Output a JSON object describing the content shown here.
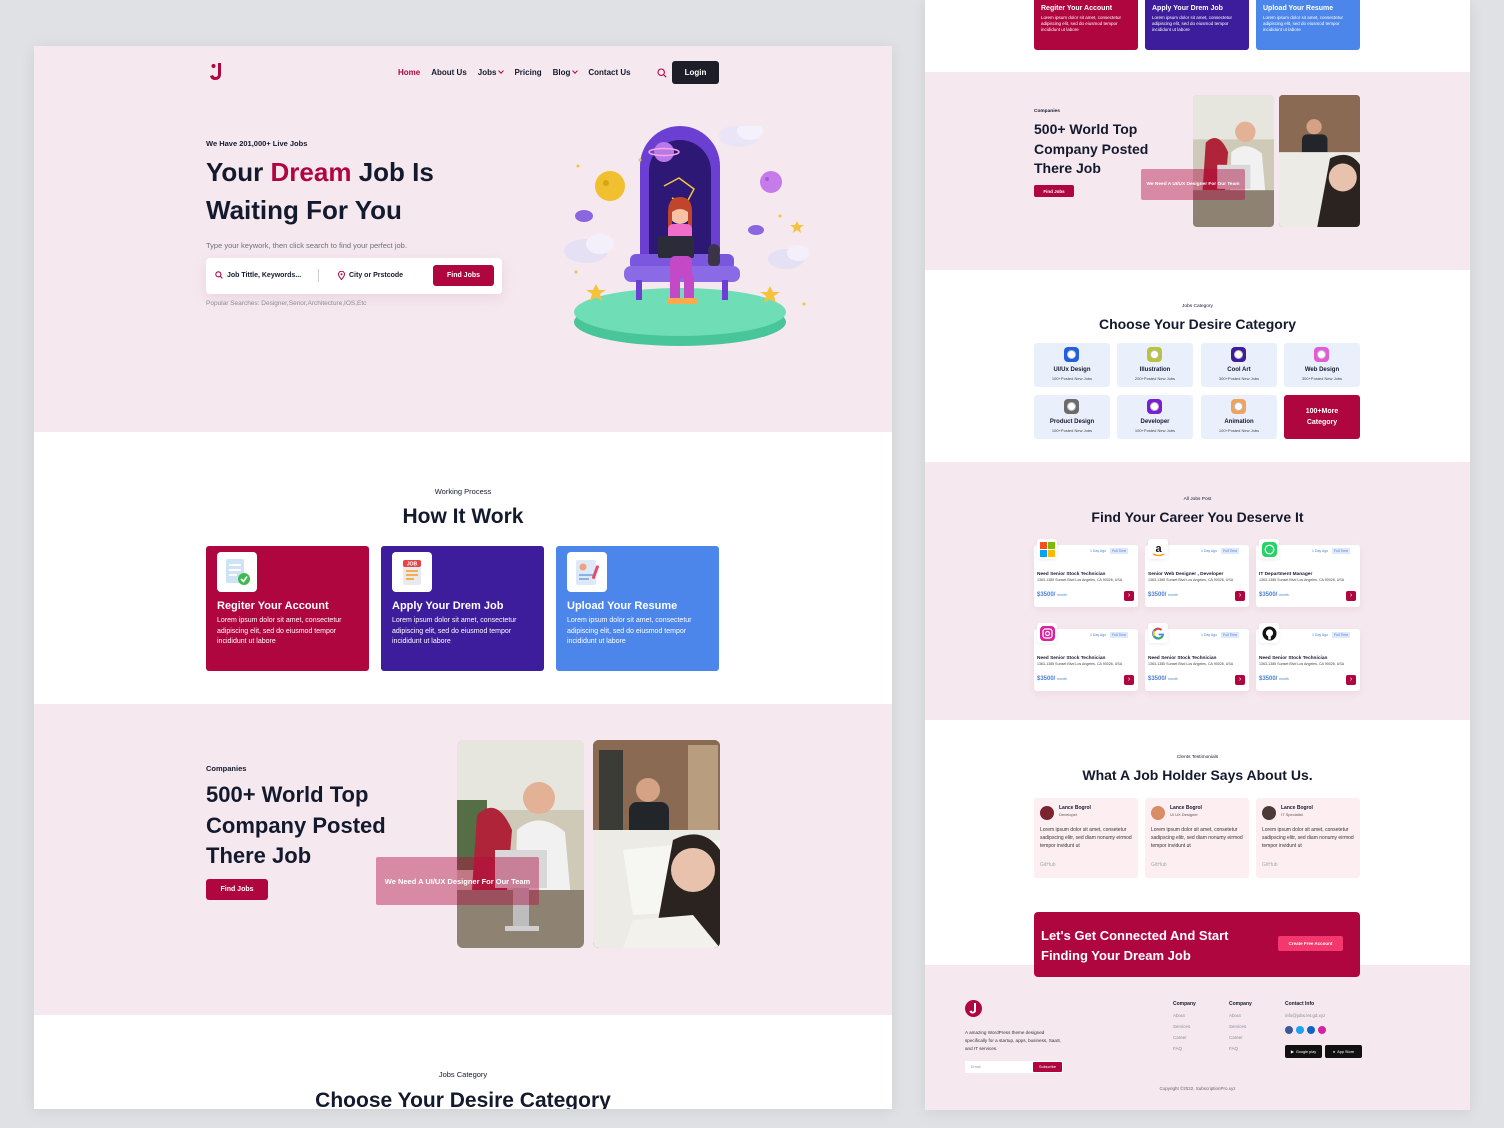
{
  "nav": {
    "items": [
      "Home",
      "About Us",
      "Jobs",
      "Pricing",
      "Blog",
      "Contact Us"
    ],
    "login": "Login"
  },
  "hero": {
    "kicker": "We Have 201,000+ Live Jobs",
    "title_a": "Your ",
    "title_accent": "Dream",
    "title_b": " Job Is Waiting For You",
    "subtitle": "Type your keywork, then click search to find your perfect job.",
    "keyword_placeholder": "Job Tittle, Keywords...",
    "location_placeholder": "City or Prstcode",
    "find_button": "Find Jobs",
    "popular": "Popular Searches: Designer,Senor,Architecture,IOS,Etc"
  },
  "how": {
    "kicker": "Working Process",
    "title": "How It Work",
    "steps": [
      {
        "title": "Regiter Your Account",
        "text": "Lorem ipsum dolor sit amet, consectetur adipiscing elit, sed do eiusmod tempor incididunt ut labore",
        "color": "#b0063f"
      },
      {
        "title": "Apply Your Drem Job",
        "text": "Lorem ipsum dolor sit amet, consectetur adipiscing elit, sed do eiusmod tempor incididunt ut labore",
        "color": "#3d1d9b"
      },
      {
        "title": "Upload Your Resume",
        "text": "Lorem ipsum dolor sit amet, consectetur adipiscing elit, sed do eiusmod tempor incididunt ut labore",
        "color": "#4c86ea"
      }
    ]
  },
  "companies": {
    "kicker": "Companies",
    "title": "500+ World Top Company Posted There Job",
    "button": "Find Jobs",
    "overlay": "We Need A UI/UX Designer For Our Team"
  },
  "categories": {
    "kicker": "Jobs Category",
    "title": "Choose Your Desire Category",
    "items": [
      {
        "name": "UI/Ux Design",
        "count": "100+Posted New Jobs",
        "color": "#1f5fe0"
      },
      {
        "name": "Illustration",
        "count": "200+Posted New Jobs",
        "color": "#b7c43a"
      },
      {
        "name": "Cool Art",
        "count": "300+Posted New Jobs",
        "color": "#3d1d9b"
      },
      {
        "name": "Web Design",
        "count": "300+Posted New Jobs",
        "color": "#e35bd8"
      },
      {
        "name": "Product Design",
        "count": "100+Posted New Jobs",
        "color": "#6b6b6b"
      },
      {
        "name": "Developer",
        "count": "100+Posted New Jobs",
        "color": "#7a1fd1"
      },
      {
        "name": "Animation",
        "count": "100+Posted New Jobs",
        "color": "#f0a35a"
      }
    ],
    "more": "100+More Category"
  },
  "jobs": {
    "kicker": "All Jobs Post",
    "title": "Find Your Career You Deserve It",
    "items": [
      {
        "logo": "microsoft-logo",
        "title": "Need Senior Stock Technician",
        "ago": "1 Day Ago",
        "type": "Full Time",
        "addr": "1363-1385 Sunset Blvd Los Angeles, CA 90026, USA",
        "salary": "$3500/",
        "unit": "month"
      },
      {
        "logo": "amazon-logo",
        "title": "Senior Web Designer , Developer",
        "ago": "1 Day Ago",
        "type": "Full Time",
        "addr": "1363-1385 Sunset Blvd Los Angeles, CA 90026, USA",
        "salary": "$3500/",
        "unit": "month"
      },
      {
        "logo": "whatsapp-logo",
        "title": "IT Department Manager",
        "ago": "1 Day Ago",
        "type": "Full Time",
        "addr": "1363-1385 Sunset Blvd Los Angeles, CA 90026, USA",
        "salary": "$3500/",
        "unit": "month"
      },
      {
        "logo": "instagram-logo",
        "title": "Need Senior Stock Technician",
        "ago": "1 Day Ago",
        "type": "Full Time",
        "addr": "1363-1385 Sunset Blvd Los Angeles, CA 90026, USA",
        "salary": "$3500/",
        "unit": "month"
      },
      {
        "logo": "google-logo",
        "title": "Need Senior Stock Technician",
        "ago": "1 Day Ago",
        "type": "Full Time",
        "addr": "1363-1385 Sunset Blvd Los Angeles, CA 90026, USA",
        "salary": "$3500/",
        "unit": "month"
      },
      {
        "logo": "github-logo",
        "title": "Need Senior Stock Technician",
        "ago": "1 Day Ago",
        "type": "Full Time",
        "addr": "1363-1385 Sunset Blvd Los Angeles, CA 90026, USA",
        "salary": "$3500/",
        "unit": "month"
      }
    ]
  },
  "testimonials": {
    "kicker": "Clents Testimonials",
    "title": "What A Job Holder Says About Us.",
    "items": [
      {
        "name": "Lance Bogrol",
        "role": "Developer",
        "text": "Lorem ipsum dolor sit amet, consetetur sadipscing elitr, sed diam nonumy eirmod tempor invidunt ut",
        "link": "GitHub"
      },
      {
        "name": "Lance Bogrol",
        "role": "UI UX Designer",
        "text": "Lorem ipsum dolor sit amet, consetetur sadipscing elitr, sed diam nonumy eirmod tempor invidunt ut",
        "link": "GitHub"
      },
      {
        "name": "Lance Bogrol",
        "role": "IT Specialist",
        "text": "Lorem ipsum dolor sit amet, consetetur sadipscing elitr, sed diam nonumy eirmod tempor invidunt ut",
        "link": "GitHub"
      }
    ]
  },
  "cta": {
    "title": "Let's Get Connected And Start Finding Your Dream Job",
    "button": "Create Free Account"
  },
  "footer": {
    "desc": "A amazing WordPress theme designed specifically for a startup, apps, business, SaaS, and IT services.",
    "email_placeholder": "Email",
    "subscribe": "Subscribe",
    "col1": {
      "title": "Company",
      "links": [
        "About",
        "Services",
        "Career",
        "FAQ"
      ]
    },
    "col2": {
      "title": "Company",
      "links": [
        "About",
        "Services",
        "Career",
        "FAQ"
      ]
    },
    "contact": {
      "title": "Contact Info",
      "email": "info@jobs.let.gd.xyz"
    },
    "google_play": "Google play",
    "app_store": "App Store",
    "copyright": "Copyright ©2022, SubscriptionPro.xyz"
  }
}
